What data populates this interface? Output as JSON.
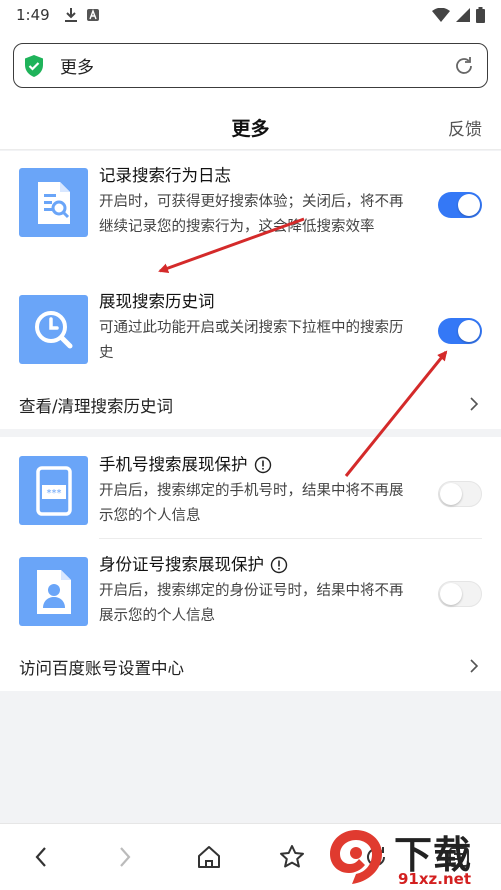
{
  "status": {
    "time": "1:49"
  },
  "address": {
    "text": "更多"
  },
  "header": {
    "title": "更多",
    "feedback": "反馈"
  },
  "items": [
    {
      "title": "记录搜索行为日志",
      "desc": "开启时，可获得更好搜索体验；关闭后，将不再继续记录您的搜索行为，这会降低搜索效率",
      "toggle": "on",
      "icon": "search-document-icon"
    },
    {
      "title": "展现搜索历史词",
      "desc": "可通过此功能开启或关闭搜索下拉框中的搜索历史",
      "toggle": "on",
      "icon": "clock-search-icon"
    },
    {
      "title": "手机号搜索展现保护",
      "desc": "开启后，搜索绑定的手机号时，结果中将不再展示您的个人信息",
      "toggle": "off",
      "icon": "phone-password-icon"
    },
    {
      "title": "身份证号搜索展现保护",
      "desc": "开启后，搜索绑定的身份证号时，结果中将不再展示您的个人信息",
      "toggle": "off",
      "icon": "id-card-icon"
    }
  ],
  "links": {
    "history": "查看/清理搜索历史词",
    "account": "访问百度账号设置中心"
  },
  "watermark": {
    "brand": "下载站",
    "domain": "91xz.net"
  },
  "colors": {
    "accent": "#3478f6",
    "icon_bg": "#6aa5f8",
    "arrow": "#d42a2a"
  }
}
